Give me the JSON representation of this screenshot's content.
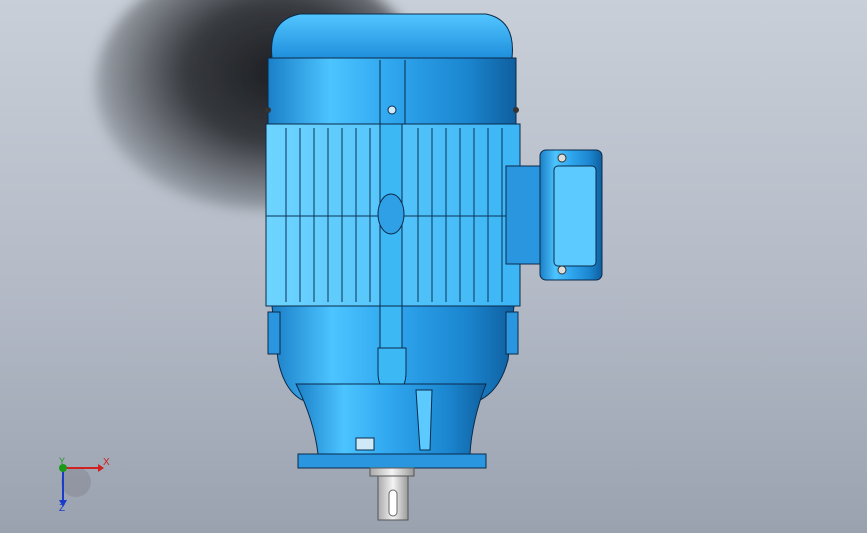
{
  "viewport": {
    "background_top": "#c9cfd8",
    "background_bottom": "#9aa2b0"
  },
  "model": {
    "body_color": "#2f9fe6",
    "highlight_color": "#7fd8ff",
    "outline_color": "#0a2a4a",
    "shaft_color": "#d8d8d8"
  },
  "triad": {
    "x_label": "X",
    "y_label": "Y",
    "z_label": "Z",
    "x_color": "#d02020",
    "y_color": "#1a9a1a",
    "z_color": "#1a3cc8"
  }
}
